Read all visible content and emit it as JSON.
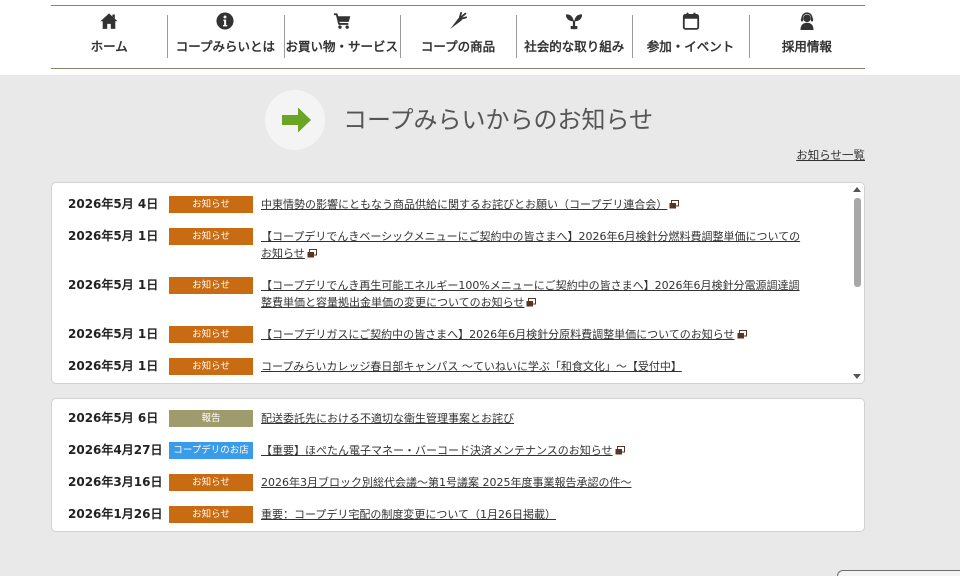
{
  "nav": {
    "items": [
      {
        "label": "ホーム",
        "icon": "home-icon"
      },
      {
        "label": "コープみらいとは",
        "icon": "info-icon"
      },
      {
        "label": "お買い物・サービス",
        "icon": "cart-icon"
      },
      {
        "label": "コープの商品",
        "icon": "carrot-icon"
      },
      {
        "label": "社会的な取り組み",
        "icon": "sprout-icon"
      },
      {
        "label": "参加・イベント",
        "icon": "calendar-icon"
      },
      {
        "label": "採用情報",
        "icon": "staff-icon"
      }
    ]
  },
  "news": {
    "heading": "コープみらいからのお知らせ",
    "heading_icon": "arrow-right-icon",
    "all_link": "お知らせ一覧",
    "lists": [
      {
        "items": [
          {
            "date": "2026年5月 4日",
            "category": "お知らせ",
            "title": "中東情勢の影響にともなう商品供給に関するお詫びとお願い（コープデリ連合会）",
            "link_icon": "new-window-icon"
          },
          {
            "date": "2026年5月 1日",
            "category": "お知らせ",
            "title": "【コープデリでんきベーシックメニューにご契約中の皆さまへ】2026年6月検針分燃料費調整単価についてのお知らせ",
            "link_icon": "new-window-icon"
          },
          {
            "date": "2026年5月 1日",
            "category": "お知らせ",
            "title": "【コープデリでんき再生可能エネルギー100%メニューにご契約中の皆さまへ】2026年6月検針分電源調達調整費単価と容量拠出金単価の変更についてのお知らせ",
            "link_icon": "new-window-icon"
          },
          {
            "date": "2026年5月 1日",
            "category": "お知らせ",
            "title": "【コープデリガスにご契約中の皆さまへ】2026年6月検針分原料費調整単価についてのお知らせ",
            "link_icon": "new-window-icon"
          },
          {
            "date": "2026年5月 1日",
            "category": "お知らせ",
            "title": "コープみらいカレッジ春日部キャンパス 〜ていねいに学ぶ「和食文化」〜【受付中】"
          }
        ]
      },
      {
        "items": [
          {
            "date": "2026年5月 6日",
            "category": "報告",
            "title": "配送委託先における不適切な衛生管理事案とお詫び"
          },
          {
            "date": "2026年4月27日",
            "category": "コープデリのお店",
            "title": "【重要】ほぺたん電子マネー・バーコード決済メンテナンスのお知らせ",
            "link_icon": "new-window-icon"
          },
          {
            "date": "2026年3月16日",
            "category": "お知らせ",
            "title": "2026年3月ブロック別総代会議〜第1号議案 2025年度事業報告承認の件〜"
          },
          {
            "date": "2026年1月26日",
            "category": "お知らせ",
            "title": "重要：コープデリ宅配の制度変更について（1月26日掲載）"
          }
        ]
      }
    ]
  },
  "category_colors": {
    "お知らせ": "#c86b12",
    "報告": "#9e9c6c",
    "コープデリのお店": "#3a9be8"
  },
  "colors": {
    "accent_green": "#6aa523"
  }
}
